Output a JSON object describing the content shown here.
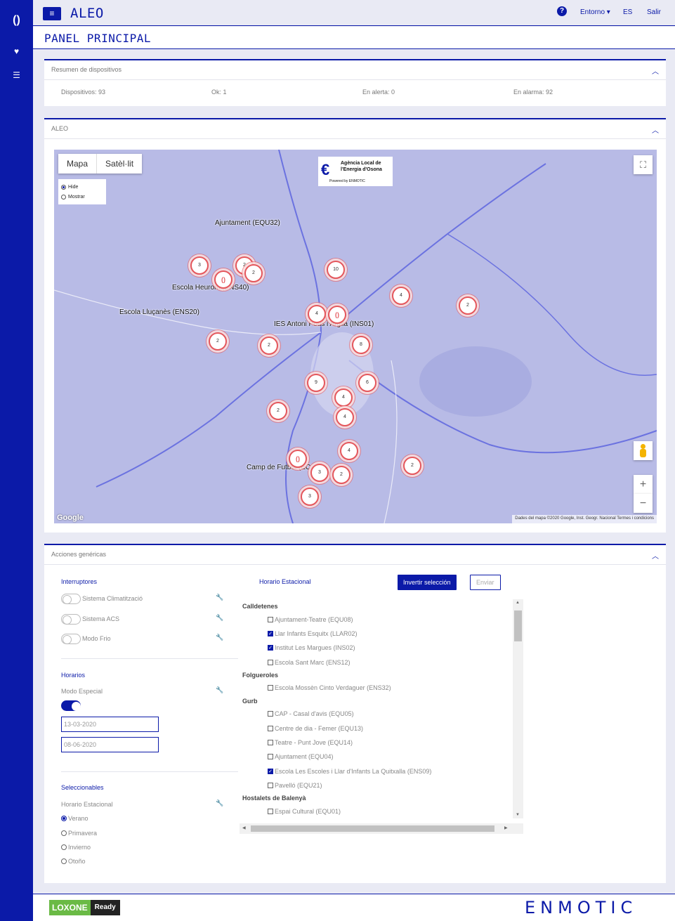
{
  "app": {
    "title": "ALEO",
    "page_title": "PANEL PRINCIPAL"
  },
  "topbar": {
    "help": "?",
    "entorno": "Entorno ▾",
    "lang": "ES",
    "salir": "Salir"
  },
  "summary": {
    "title": "Resumen de dispositivos",
    "dispositivos": "Dispositivos: 93",
    "ok": "Ok: 1",
    "alerta": "En alerta: 0",
    "alarma": "En alarma: 92"
  },
  "map_card": {
    "title": "ALEO",
    "tabs": [
      "Mapa",
      "Satèl·lit"
    ],
    "layer_hide": "Hide",
    "layer_show": "Mostrar",
    "logo_line1": "Agència Local de",
    "logo_line2": "l'Energia d'Osona",
    "logo_line3": "Powered by ENMOTIC",
    "zoom_in": "+",
    "zoom_out": "−",
    "fullscreen": "⛶",
    "attribution": "Dades del mapa ©2020 Google, Inst. Geogr. Nacional    Termes i condicions",
    "google": "Google",
    "labels": [
      "Ajuntament (EQU32)",
      "Escola Heurom (ENS40)",
      "Escola Lluçanès (ENS20)",
      "IES Antoni Pous i Argila (INS01)",
      "Camp de Futbol (EC"
    ],
    "clusters": [
      "2",
      "10",
      "2",
      "3",
      "4",
      "2",
      "4",
      "2",
      "2",
      "8",
      "9",
      "6",
      "4",
      "2",
      "4",
      "4",
      "3",
      "2",
      "3",
      "2"
    ]
  },
  "actions": {
    "title": "Acciones genéricas",
    "interruptores": {
      "title": "Interruptores",
      "items": [
        "Sistema Climatització",
        "Sistema ACS",
        "Modo Frio"
      ]
    },
    "horarios": {
      "title": "Horarios",
      "modo_especial": "Modo Especial",
      "date_from": "13-03-2020",
      "date_to": "08-06-2020"
    },
    "seleccionables": {
      "title": "Seleccionables",
      "label": "Horario Estacional",
      "options": [
        "Verano",
        "Primavera",
        "Invierno",
        "Otoño"
      ]
    },
    "horario_estacional": {
      "title": "Horario Estacional",
      "invert_btn": "Invertir selección",
      "send_btn": "Enviar",
      "groups": [
        {
          "name": "Calldetenes",
          "items": [
            {
              "label": "Ajuntament-Teatre (EQU08)",
              "checked": false
            },
            {
              "label": "Llar Infants Esquitx (LLAR02)",
              "checked": true
            },
            {
              "label": "Institut Les Margues (INS02)",
              "checked": true
            },
            {
              "label": "Escola Sant Marc (ENS12)",
              "checked": false
            }
          ]
        },
        {
          "name": "Folgueroles",
          "items": [
            {
              "label": "Escola Mossèn Cinto Verdaguer (ENS32)",
              "checked": false
            }
          ]
        },
        {
          "name": "Gurb",
          "items": [
            {
              "label": "CAP - Casal d'avis (EQU05)",
              "checked": false
            },
            {
              "label": "Centre de dia - Femer (EQU13)",
              "checked": false
            },
            {
              "label": "Teatre - Punt Jove (EQU14)",
              "checked": false
            },
            {
              "label": "Ajuntament (EQU04)",
              "checked": false
            },
            {
              "label": "Escola Les Escoles i Llar d'Infants La Quitxalla (ENS09)",
              "checked": true
            },
            {
              "label": "Pavelló (EQU21)",
              "checked": false
            }
          ]
        },
        {
          "name": "Hostalets de Balenyà",
          "items": [
            {
              "label": "Espai Cultural (EQU01)",
              "checked": false
            }
          ]
        }
      ]
    }
  },
  "footer": {
    "loxone": "LOXONE",
    "ready": "Ready",
    "brand": "ENMOTIC"
  }
}
